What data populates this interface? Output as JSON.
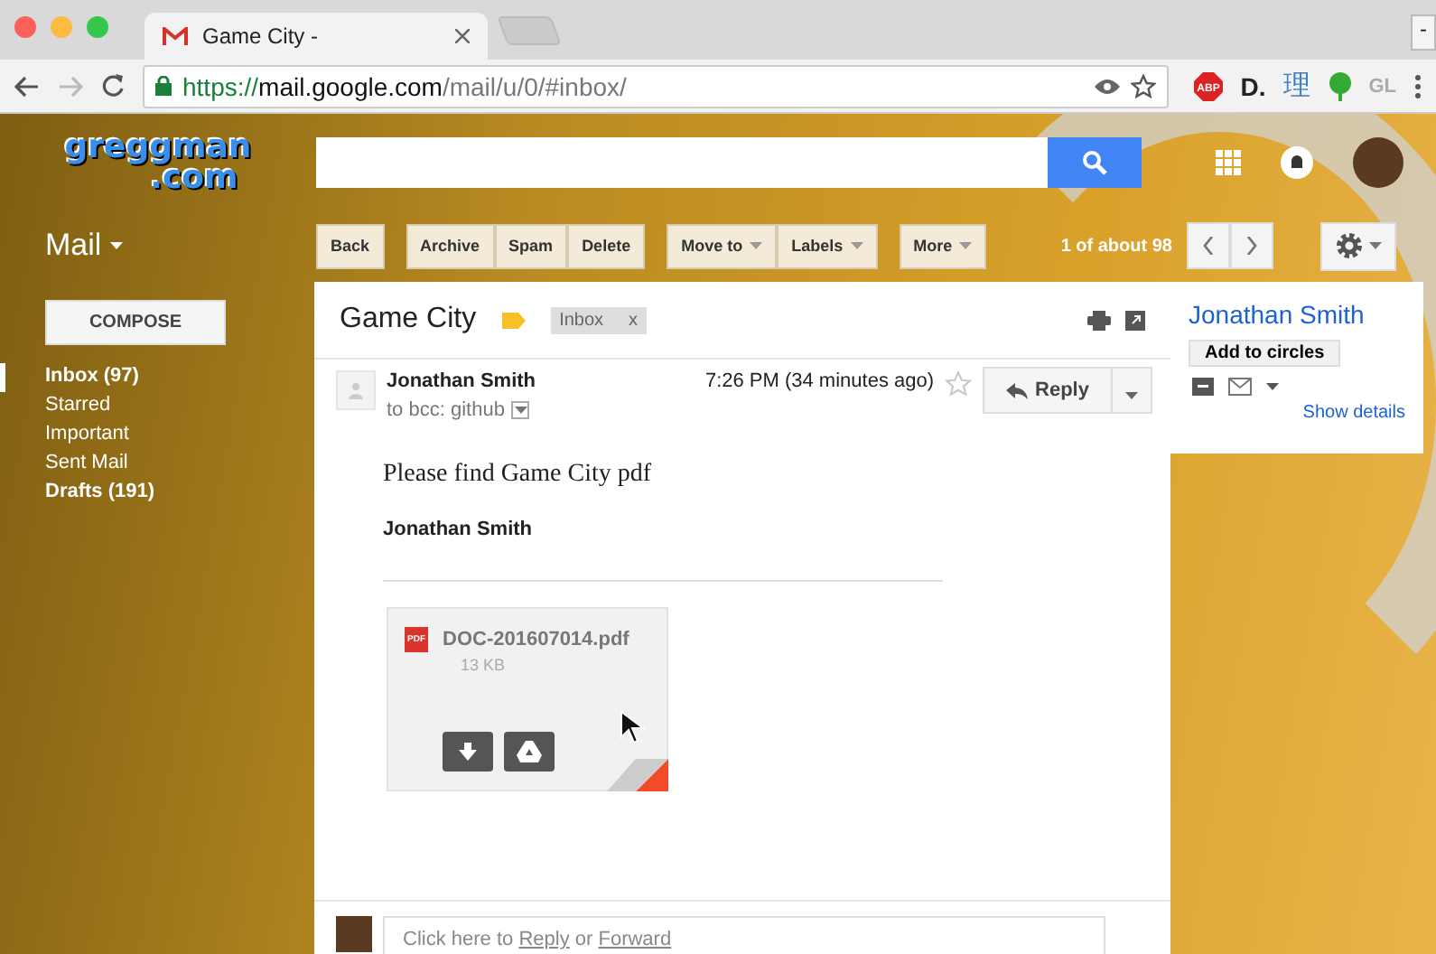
{
  "browser": {
    "tabs": [
      {
        "title": "Game City -",
        "selected": true
      }
    ],
    "window_control": "-",
    "url": {
      "scheme": "https://",
      "host": "mail.google.com",
      "path": "/mail/u/0/#inbox/"
    },
    "extensions": [
      {
        "kind": "stop",
        "label": "ABP"
      },
      {
        "kind": "text",
        "label": "D."
      },
      {
        "kind": "cjk",
        "label": "理"
      },
      {
        "kind": "pin"
      },
      {
        "kind": "grey",
        "label": "GL"
      }
    ]
  },
  "logo": {
    "line_1": "greggman",
    "line_2": ".com"
  },
  "mail_menu": "Mail",
  "compose": "COMPOSE",
  "nav": [
    {
      "label": "Inbox (97)",
      "bold": true,
      "selected": true
    },
    {
      "label": "Starred",
      "bold": false,
      "selected": false
    },
    {
      "label": "Important",
      "bold": false,
      "selected": false
    },
    {
      "label": "Sent Mail",
      "bold": false,
      "selected": false
    },
    {
      "label": "Drafts (191)",
      "bold": true,
      "selected": false
    }
  ],
  "toolbar": [
    [
      {
        "label": "Back",
        "has_menu": false
      }
    ],
    [
      {
        "label": "Archive",
        "has_menu": false
      },
      {
        "label": "Spam",
        "has_menu": false
      },
      {
        "label": "Delete",
        "has_menu": false
      }
    ],
    [
      {
        "label": "Move to",
        "has_menu": true
      },
      {
        "label": "Labels",
        "has_menu": true
      }
    ],
    [
      {
        "label": "More",
        "has_menu": true
      }
    ]
  ],
  "pager": "1 of about 98",
  "thread": {
    "subject": "Game City",
    "label_chip": "Inbox",
    "chip_close": "x"
  },
  "message": {
    "sender": "Jonathan Smith",
    "recipients": "to bcc: github",
    "time": "7:26 PM (34 minutes ago)",
    "starred": false,
    "reply": "Reply",
    "body": "Please find Game City pdf",
    "signature": "Jonathan Smith"
  },
  "attachment": {
    "name": "DOC-201607014.pdf",
    "size": "13 KB",
    "badge": "PDF"
  },
  "reply_box": {
    "before": "Click here to ",
    "reply_link": "Reply",
    "middle": " or ",
    "forward_link": "Forward"
  },
  "contact": {
    "name": "Jonathan Smith",
    "add": "Add to circles",
    "details": "Show details"
  }
}
